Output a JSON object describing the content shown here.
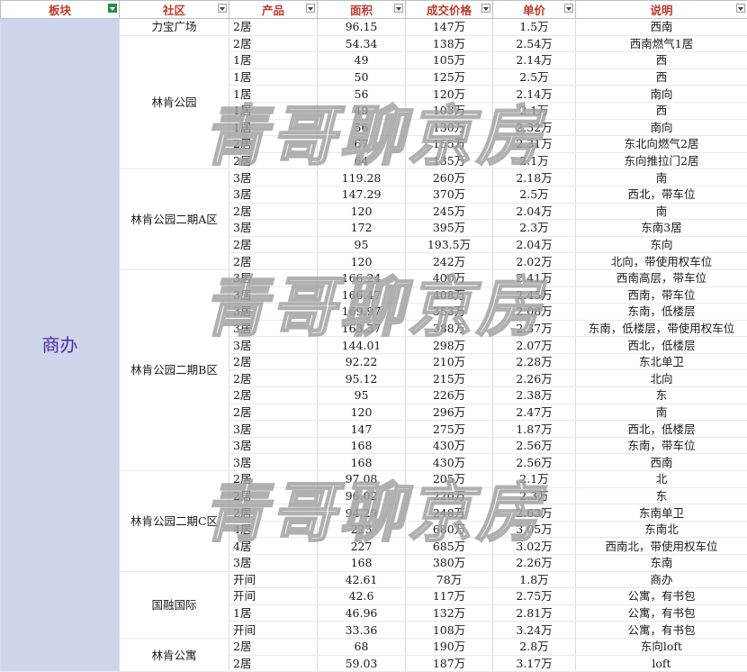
{
  "headers": [
    "板块",
    "社区",
    "产品",
    "面积",
    "成交价格",
    "单价",
    "说明"
  ],
  "block": "商办",
  "watermark": "青哥聊京房",
  "groups": [
    {
      "community": "力宝广场",
      "rows": [
        [
          "2居",
          "96.15",
          "147万",
          "1.5万",
          "西南"
        ]
      ]
    },
    {
      "community": "林肯公园",
      "rows": [
        [
          "2居",
          "54.34",
          "138万",
          "2.54万",
          "西南燃气1居"
        ],
        [
          "1居",
          "49",
          "105万",
          "2.14万",
          "西"
        ],
        [
          "1居",
          "50",
          "125万",
          "2.5万",
          "西"
        ],
        [
          "1居",
          "56",
          "120万",
          "2.14万",
          "南向"
        ],
        [
          "1居",
          "49",
          "103万",
          "2.1万",
          "西"
        ],
        [
          "1居",
          "56",
          "130万",
          "2.32万",
          "南向"
        ],
        [
          "2居",
          "67",
          "155万",
          "2.31万",
          "东北向燃气2居"
        ],
        [
          "2居",
          "64",
          "135万",
          "2.1万",
          "东向推拉门2居"
        ]
      ]
    },
    {
      "community": "林肯公园二期A区",
      "rows": [
        [
          "3居",
          "119.28",
          "260万",
          "2.18万",
          "南"
        ],
        [
          "3居",
          "147.29",
          "370万",
          "2.5万",
          "西北，带车位"
        ],
        [
          "2居",
          "120",
          "245万",
          "2.04万",
          "南"
        ],
        [
          "3居",
          "172",
          "395万",
          "2.3万",
          "东南3居"
        ],
        [
          "2居",
          "95",
          "193.5万",
          "2.04万",
          "东向"
        ],
        [
          "2居",
          "120",
          "242万",
          "2.02万",
          "北向，带使用权车位"
        ]
      ]
    },
    {
      "community": "林肯公园二期B区",
      "rows": [
        [
          "3居",
          "166.24",
          "400万",
          "2.41万",
          "西南高层，带车位"
        ],
        [
          "3居",
          "166.47",
          "408万",
          "2.45万",
          "西南，带车位"
        ],
        [
          "3居",
          "169.97",
          "353万",
          "2.08万",
          "东南，低楼层"
        ],
        [
          "3居",
          "163.37",
          "388万",
          "2.37万",
          "东南，低楼层，带使用权车位"
        ],
        [
          "3居",
          "144.01",
          "298万",
          "2.07万",
          "西北，低楼层"
        ],
        [
          "2居",
          "92.22",
          "210万",
          "2.28万",
          "东北单卫"
        ],
        [
          "2居",
          "95.12",
          "215万",
          "2.26万",
          "北向"
        ],
        [
          "2居",
          "95",
          "226万",
          "2.38万",
          "东"
        ],
        [
          "2居",
          "120",
          "296万",
          "2.47万",
          "南"
        ],
        [
          "3居",
          "147",
          "275万",
          "1.87万",
          "西北，低楼层"
        ],
        [
          "3居",
          "168",
          "430万",
          "2.56万",
          "东南，带车位"
        ],
        [
          "3居",
          "168",
          "430万",
          "2.56万",
          "西南"
        ]
      ]
    },
    {
      "community": "林肯公园二期C区",
      "rows": [
        [
          "2居",
          "97.08",
          "205万",
          "2.1万",
          "北"
        ],
        [
          "2居",
          "96.02",
          "220万",
          "2.3万",
          "东"
        ],
        [
          "2居",
          "94.29",
          "248万",
          "2.63万",
          "东南单卫"
        ],
        [
          "4居",
          "223",
          "680万",
          "3.05万",
          "东南北"
        ],
        [
          "4居",
          "227",
          "685万",
          "3.02万",
          "西南北，带使用权车位"
        ],
        [
          "3居",
          "168",
          "380万",
          "2.26万",
          "东南"
        ]
      ]
    },
    {
      "community": "国融国际",
      "rows": [
        [
          "开间",
          "42.61",
          "78万",
          "1.8万",
          "商办"
        ],
        [
          "开间",
          "42.6",
          "117万",
          "2.75万",
          "公寓，有书包"
        ],
        [
          "1居",
          "46.96",
          "132万",
          "2.81万",
          "公寓，有书包"
        ],
        [
          "开间",
          "33.36",
          "108万",
          "3.24万",
          "公寓，有书包"
        ]
      ]
    },
    {
      "community": "林肯公寓",
      "rows": [
        [
          "2居",
          "68",
          "190万",
          "2.8万",
          "东向loft"
        ],
        [
          "2居",
          "59.03",
          "187万",
          "3.17万",
          "loft"
        ]
      ]
    }
  ]
}
